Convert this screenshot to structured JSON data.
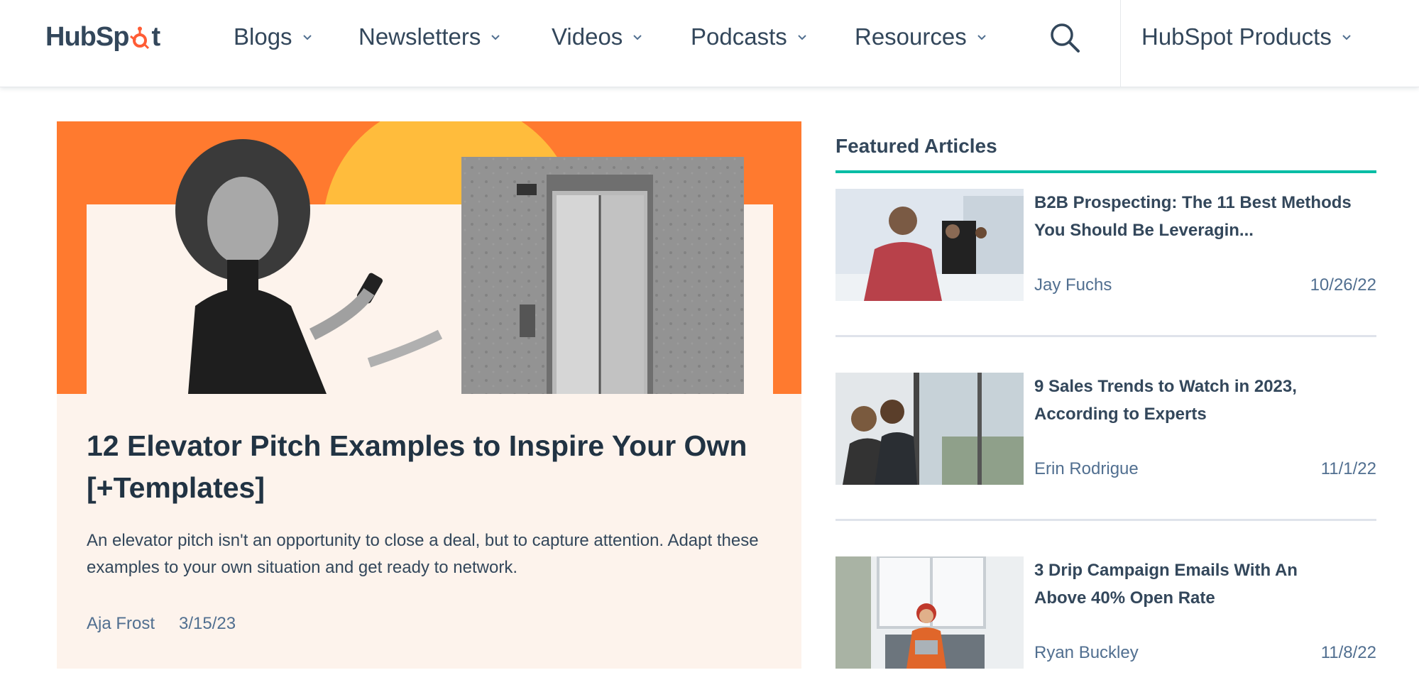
{
  "header": {
    "logo_text_left": "HubSp",
    "logo_text_right": "t",
    "nav": [
      {
        "label": "Blogs"
      },
      {
        "label": "Newsletters"
      },
      {
        "label": "Videos"
      },
      {
        "label": "Podcasts"
      },
      {
        "label": "Resources"
      }
    ],
    "search_icon": "search-icon",
    "products_label": "HubSpot Products"
  },
  "hero": {
    "title": "12 Elevator Pitch Examples to Inspire Your Own [+Templates]",
    "description": "An elevator pitch isn't an opportunity to close a deal, but to capture attention. Adapt these examples to your own situation and get ready to network.",
    "author": "Aja Frost",
    "date": "3/15/23"
  },
  "featured": {
    "heading": "Featured Articles",
    "articles": [
      {
        "title_line1": "B2B Prospecting: The 11 Best Methods",
        "title_line2": "You Should Be Leveragin...",
        "author": "Jay Fuchs",
        "date": "10/26/22"
      },
      {
        "title_line1": "9 Sales Trends to Watch in 2023,",
        "title_line2": "According to Experts",
        "author": "Erin Rodrigue",
        "date": "11/1/22"
      },
      {
        "title_line1": "3 Drip Campaign Emails With An",
        "title_line2": "Above 40% Open Rate",
        "author": "Ryan Buckley",
        "date": "11/8/22"
      }
    ]
  },
  "colors": {
    "brand_orange": "#ff7a2f",
    "accent_teal": "#00bda5",
    "text_dark": "#33475b",
    "hero_bg": "#fdf3ec"
  }
}
